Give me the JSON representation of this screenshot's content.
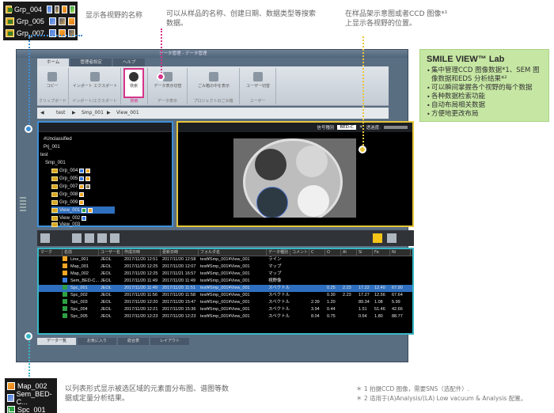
{
  "colors": {
    "blue": "#3d8fd8",
    "pink": "#d6338a",
    "yellow": "#e7c63a",
    "teal": "#38b7c6",
    "green_box": "#c6e7a3"
  },
  "legend_top": [
    "Grp_004",
    "Grp_005",
    "Grp_007"
  ],
  "legend_bottom": [
    "Map_002",
    "Sem_BED-C...",
    "Spc_001"
  ],
  "callouts": {
    "view_name": "显示各视野的名称",
    "search": "可以从样品的名称、创建日期、数据类型等搜索数据。",
    "position": "在样品架示意图或者CCD 图像*¹ 上显示各视野的位置。",
    "list": "以列表形式显示被选区域的元素面分布图、谱图等数据或定量分析结果。"
  },
  "smile": {
    "title": "SMILE VIEW™ Lab",
    "items": [
      "集中管理CCD 图像数据*1、SEM 图像数据和EDS 分析结果*²",
      "可以瞬间掌握各个视野的每个数据",
      "各种数据检索功能",
      "自动布局相关数据",
      "方便地更改布局"
    ]
  },
  "footnotes": [
    "＊ 1 拍摄CCD 图像，需要SNS（选配件）.",
    "＊ 2 适用于(A)Analysis/(LA) Low vacuum & Analysis 配置。"
  ],
  "app": {
    "title": "データ管理 - データ管理",
    "tabs": [
      "ホーム",
      "管理者設定",
      "ヘルプ"
    ],
    "ribbon": [
      {
        "label": "コピー",
        "group": "クリップボード"
      },
      {
        "label": "インポート エクスポート",
        "group": "インポート/エクスポート"
      },
      {
        "label": "検索",
        "group": "検索"
      },
      {
        "label": "データ表示切替",
        "group": "データ表示"
      },
      {
        "label": "ごみ箱の中を表示",
        "group": "プロジェクトのごみ箱"
      },
      {
        "label": "ユーザー切替",
        "group": "ユーザー"
      }
    ],
    "breadcrumb": [
      "test",
      "Smp_001",
      "View_001"
    ],
    "tree": [
      {
        "label": "#Unclassified",
        "indent": 1
      },
      {
        "label": "Prj_001",
        "indent": 1
      },
      {
        "label": "test",
        "indent": 0
      },
      {
        "label": "Smp_001",
        "indent": 1
      },
      {
        "label": "Grp_004",
        "indent": 2
      },
      {
        "label": "Grp_005",
        "indent": 2
      },
      {
        "label": "Grp_007",
        "indent": 2
      },
      {
        "label": "Grp_008",
        "indent": 2
      },
      {
        "label": "Grp_009",
        "indent": 2
      },
      {
        "label": "View_001",
        "indent": 2,
        "selected": true
      },
      {
        "label": "View_002",
        "indent": 2
      },
      {
        "label": "View_003",
        "indent": 2
      }
    ],
    "view_toolbar": [
      "信号種別",
      "BED-C",
      "透過度:"
    ],
    "columns": [
      "マーク",
      "名前",
      "ユーザー名",
      "作成日時",
      "更新日時",
      "フォルダ名",
      "データ種別",
      "コメント",
      "C",
      "O",
      "Al",
      "Si",
      "Fe",
      "Ni"
    ],
    "rows": [
      [
        "Line_001",
        "JEOL",
        "2017/11/20 12:51",
        "2017/11/20 12:58",
        "test¥Smp_001¥View_001",
        "ライン",
        "",
        "",
        "",
        "",
        "",
        "",
        ""
      ],
      [
        "Map_001",
        "JEOL",
        "2017/11/20 12:25",
        "2017/11/20 12:07",
        "test¥Smp_001¥View_001",
        "マップ",
        "",
        "",
        "",
        "",
        "",
        "",
        ""
      ],
      [
        "Map_002",
        "JEOL",
        "2017/11/20 12:25",
        "2017/11/21 16:57",
        "test¥Smp_001¥View_001",
        "マップ",
        "",
        "",
        "",
        "",
        "",
        "",
        ""
      ],
      [
        "Sem_BED-C...",
        "JEOL",
        "2017/11/20 11:49",
        "2017/11/20 11:49",
        "test¥Smp_001¥View_001",
        "視野像",
        "",
        "",
        "",
        "",
        "",
        "",
        ""
      ],
      [
        "Spc_001",
        "JEOL",
        "2017/11/20 11:49",
        "2017/11/20 11:51",
        "test¥Smp_001¥View_001",
        "スペクトル",
        "",
        "",
        "0.25",
        "2.23",
        "17.22",
        "12.40",
        "67.90"
      ],
      [
        "Spc_002",
        "JEOL",
        "2017/11/20 11:56",
        "2017/11/20 11:58",
        "test¥Smp_001¥View_001",
        "スペクトル",
        "",
        "",
        "0.30",
        "2.23",
        "17.27",
        "12.56",
        "67.64"
      ],
      [
        "Spc_003",
        "JEOL",
        "2017/11/20 12:20",
        "2017/11/20 15:47",
        "test¥Smp_001¥View_001",
        "スペクトル",
        "",
        "2.39",
        "1.20",
        "",
        "89.34",
        "1.08",
        "5.99"
      ],
      [
        "Spc_004",
        "JEOL",
        "2017/11/20 12:21",
        "2017/11/20 15:36",
        "test¥Smp_001¥View_001",
        "スペクトル",
        "",
        "3.94",
        "0.44",
        "",
        "1.51",
        "51.46",
        "42.66"
      ],
      [
        "Spc_005",
        "JEOL",
        "2017/11/20 12:23",
        "2017/11/20 12:23",
        "test¥Smp_001¥View_001",
        "スペクトル",
        "",
        "8.04",
        "0.75",
        "",
        "0.64",
        "1.80",
        "88.77"
      ]
    ],
    "bottom_tabs": [
      "データ一覧",
      "お気に入り",
      "総合表",
      "レイアウト"
    ]
  }
}
